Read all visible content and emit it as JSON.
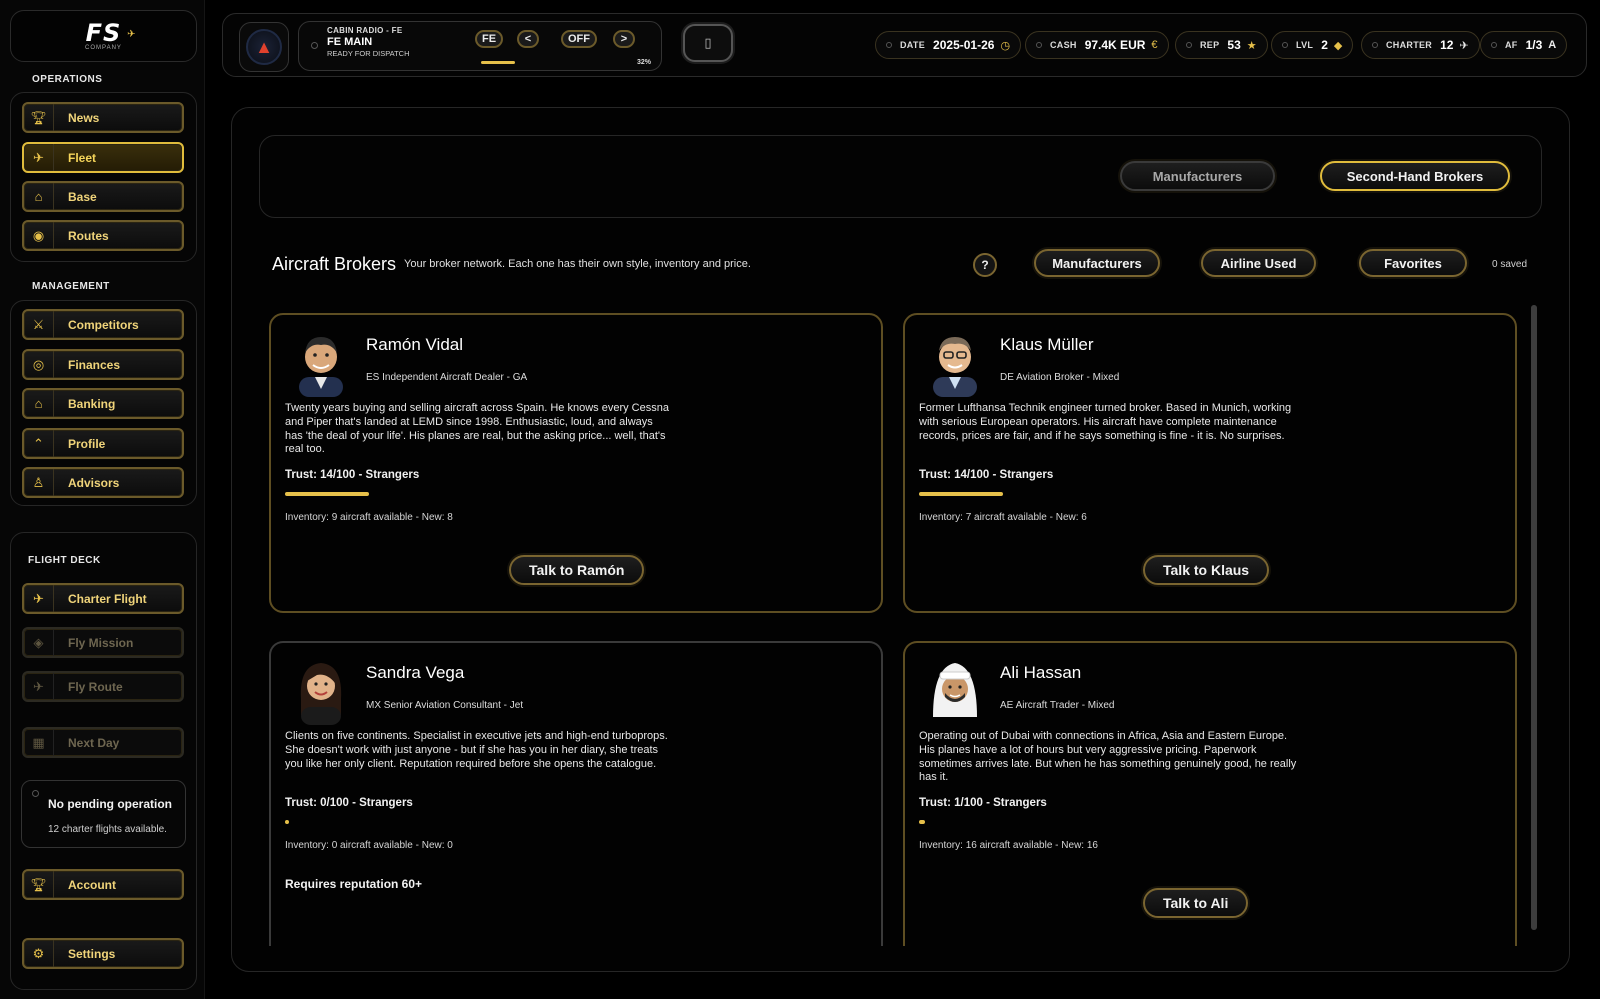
{
  "logo": {
    "text": "FS",
    "sub": "COMPANY"
  },
  "sidebar": {
    "operations_title": "OPERATIONS",
    "operations": [
      {
        "label": "News",
        "icon": "trophy-icon"
      },
      {
        "label": "Fleet",
        "icon": "plane-icon",
        "active": true
      },
      {
        "label": "Base",
        "icon": "hangar-icon"
      },
      {
        "label": "Routes",
        "icon": "globe-icon"
      }
    ],
    "management_title": "MANAGEMENT",
    "management": [
      {
        "label": "Competitors",
        "icon": "swords-icon"
      },
      {
        "label": "Finances",
        "icon": "coins-icon"
      },
      {
        "label": "Banking",
        "icon": "bank-icon"
      },
      {
        "label": "Profile",
        "icon": "wings-icon"
      },
      {
        "label": "Advisors",
        "icon": "advisor-icon"
      }
    ],
    "flightdeck_title": "FLIGHT DECK",
    "flightdeck": [
      {
        "label": "Charter Flight",
        "icon": "plane-icon"
      },
      {
        "label": "Fly Mission",
        "icon": "target-icon",
        "disabled": true
      },
      {
        "label": "Fly Route",
        "icon": "plane-icon",
        "disabled": true
      },
      {
        "label": "Next Day",
        "icon": "calendar-icon",
        "disabled": true
      }
    ],
    "pending": {
      "title": "No pending operation",
      "sub": "12 charter flights available."
    },
    "account": {
      "label": "Account",
      "icon": "trophy-icon"
    },
    "settings": {
      "label": "Settings",
      "icon": "gear-icon"
    }
  },
  "topbar": {
    "radio": {
      "title": "CABIN RADIO - FE",
      "station": "FE MAIN",
      "status": "READY FOR DISPATCH",
      "btn_station": "FE",
      "btn_prev": "<",
      "btn_off": "OFF",
      "btn_next": ">",
      "volume": "32%",
      "volume_fraction": 0.32
    },
    "stats": [
      {
        "key": "DATE",
        "value": "2025-01-26",
        "glyph": "◷"
      },
      {
        "key": "CASH",
        "value": "97.4K EUR",
        "glyph": "€"
      },
      {
        "key": "REP",
        "value": "53",
        "glyph": "★"
      },
      {
        "key": "LVL",
        "value": "2",
        "glyph": "◆"
      },
      {
        "key": "CHARTER",
        "value": "12",
        "glyph": "✈"
      },
      {
        "key": "AF",
        "value": "1/3",
        "glyph": "A"
      }
    ]
  },
  "toolbar": {
    "manufacturers": "Manufacturers",
    "second_hand": "Second-Hand Brokers"
  },
  "brokers": {
    "title": "Aircraft Brokers",
    "subtitle": "Your broker network. Each one has their own style, inventory and price.",
    "help": "?",
    "filter_manufacturers": "Manufacturers",
    "filter_airline_used": "Airline Used",
    "filter_favorites": "Favorites",
    "saved": "0 saved",
    "cards": [
      {
        "name": "Ramón Vidal",
        "role": "ES Independent Aircraft Dealer - GA",
        "desc": "Twenty years buying and selling aircraft across Spain. He knows every Cessna and Piper that's landed at LEMD since 1998. Enthusiastic, loud, and always has 'the deal of your life'. His planes are real, but the asking price... well, that's real too.",
        "trust_text": "Trust: 14/100  -  Strangers",
        "trust": 14,
        "inventory": "Inventory: 9 aircraft available  -  New: 8",
        "talk": "Talk to Ramón"
      },
      {
        "name": "Klaus Müller",
        "role": "DE Aviation Broker - Mixed",
        "desc": "Former Lufthansa Technik engineer turned broker. Based in Munich, working with serious European operators. His aircraft have complete maintenance records, prices are fair, and if he says something is fine - it is. No surprises.",
        "trust_text": "Trust: 14/100  -  Strangers",
        "trust": 14,
        "inventory": "Inventory: 7 aircraft available  -  New: 6",
        "talk": "Talk to Klaus"
      },
      {
        "name": "Sandra Vega",
        "role": "MX Senior Aviation Consultant - Jet",
        "desc": "Clients on five continents. Specialist in executive jets and high-end turboprops. She doesn't work with just anyone - but if she has you in her diary, she treats you like her only client. Reputation required before she opens the catalogue.",
        "trust_text": "Trust: 0/100  -  Strangers",
        "trust": 0,
        "inventory": "Inventory: 0 aircraft available  -  New: 0",
        "requirement": "Requires reputation 60+"
      },
      {
        "name": "Ali Hassan",
        "role": "AE Aircraft Trader - Mixed",
        "desc": "Operating out of Dubai with connections in Africa, Asia and Eastern Europe. His planes have a lot of hours but very aggressive pricing. Paperwork sometimes arrives late. But when he has something genuinely good, he really has it.",
        "trust_text": "Trust: 1/100  -  Strangers",
        "trust": 1,
        "inventory": "Inventory: 16 aircraft available  -  New: 16",
        "talk": "Talk to Ali"
      }
    ]
  },
  "colors": {
    "accent": "#e6c04a",
    "border_gold": "#6b5a2a",
    "bg": "#000000"
  }
}
